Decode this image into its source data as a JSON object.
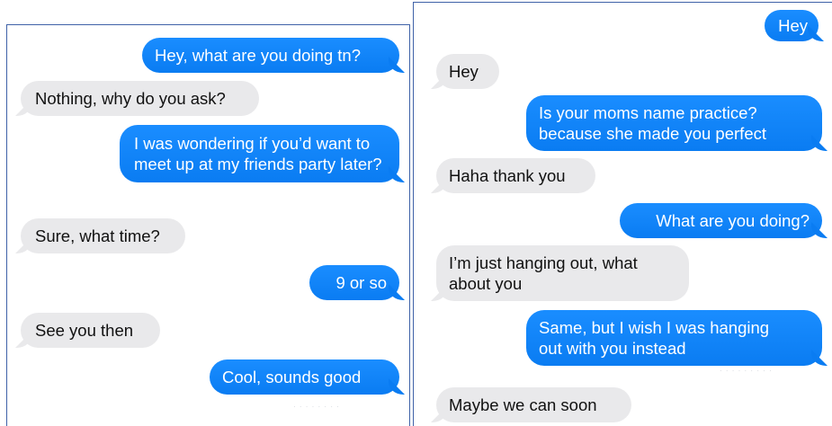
{
  "left_conversation": {
    "messages": [
      {
        "direction": "sent",
        "text": "Hey, what are you doing tn?"
      },
      {
        "direction": "received",
        "text": "Nothing, why do you ask?"
      },
      {
        "direction": "sent",
        "text": "I was wondering if you’d want to meet up at my friends party later?"
      },
      {
        "direction": "received",
        "text": "Sure, what time?"
      },
      {
        "direction": "sent",
        "text": "9 or so"
      },
      {
        "direction": "received",
        "text": "See you then"
      },
      {
        "direction": "sent",
        "text": "Cool, sounds good"
      }
    ]
  },
  "right_conversation": {
    "messages": [
      {
        "direction": "sent",
        "text": "Hey"
      },
      {
        "direction": "received",
        "text": "Hey"
      },
      {
        "direction": "sent",
        "text": "Is your moms name practice?\nbecause she made you perfect"
      },
      {
        "direction": "received",
        "text": "Haha thank you"
      },
      {
        "direction": "sent",
        "text": "What are you doing?"
      },
      {
        "direction": "received",
        "text": "I’m just hanging out, what\nabout you"
      },
      {
        "direction": "sent",
        "text": "Same, but I wish I was hanging\nout with you instead"
      },
      {
        "direction": "received",
        "text": "Maybe we can soon"
      }
    ]
  },
  "colors": {
    "sent_bubble": "#0a7cf2",
    "received_bubble": "#e9e9eb",
    "panel_border": "#3f62a8"
  }
}
